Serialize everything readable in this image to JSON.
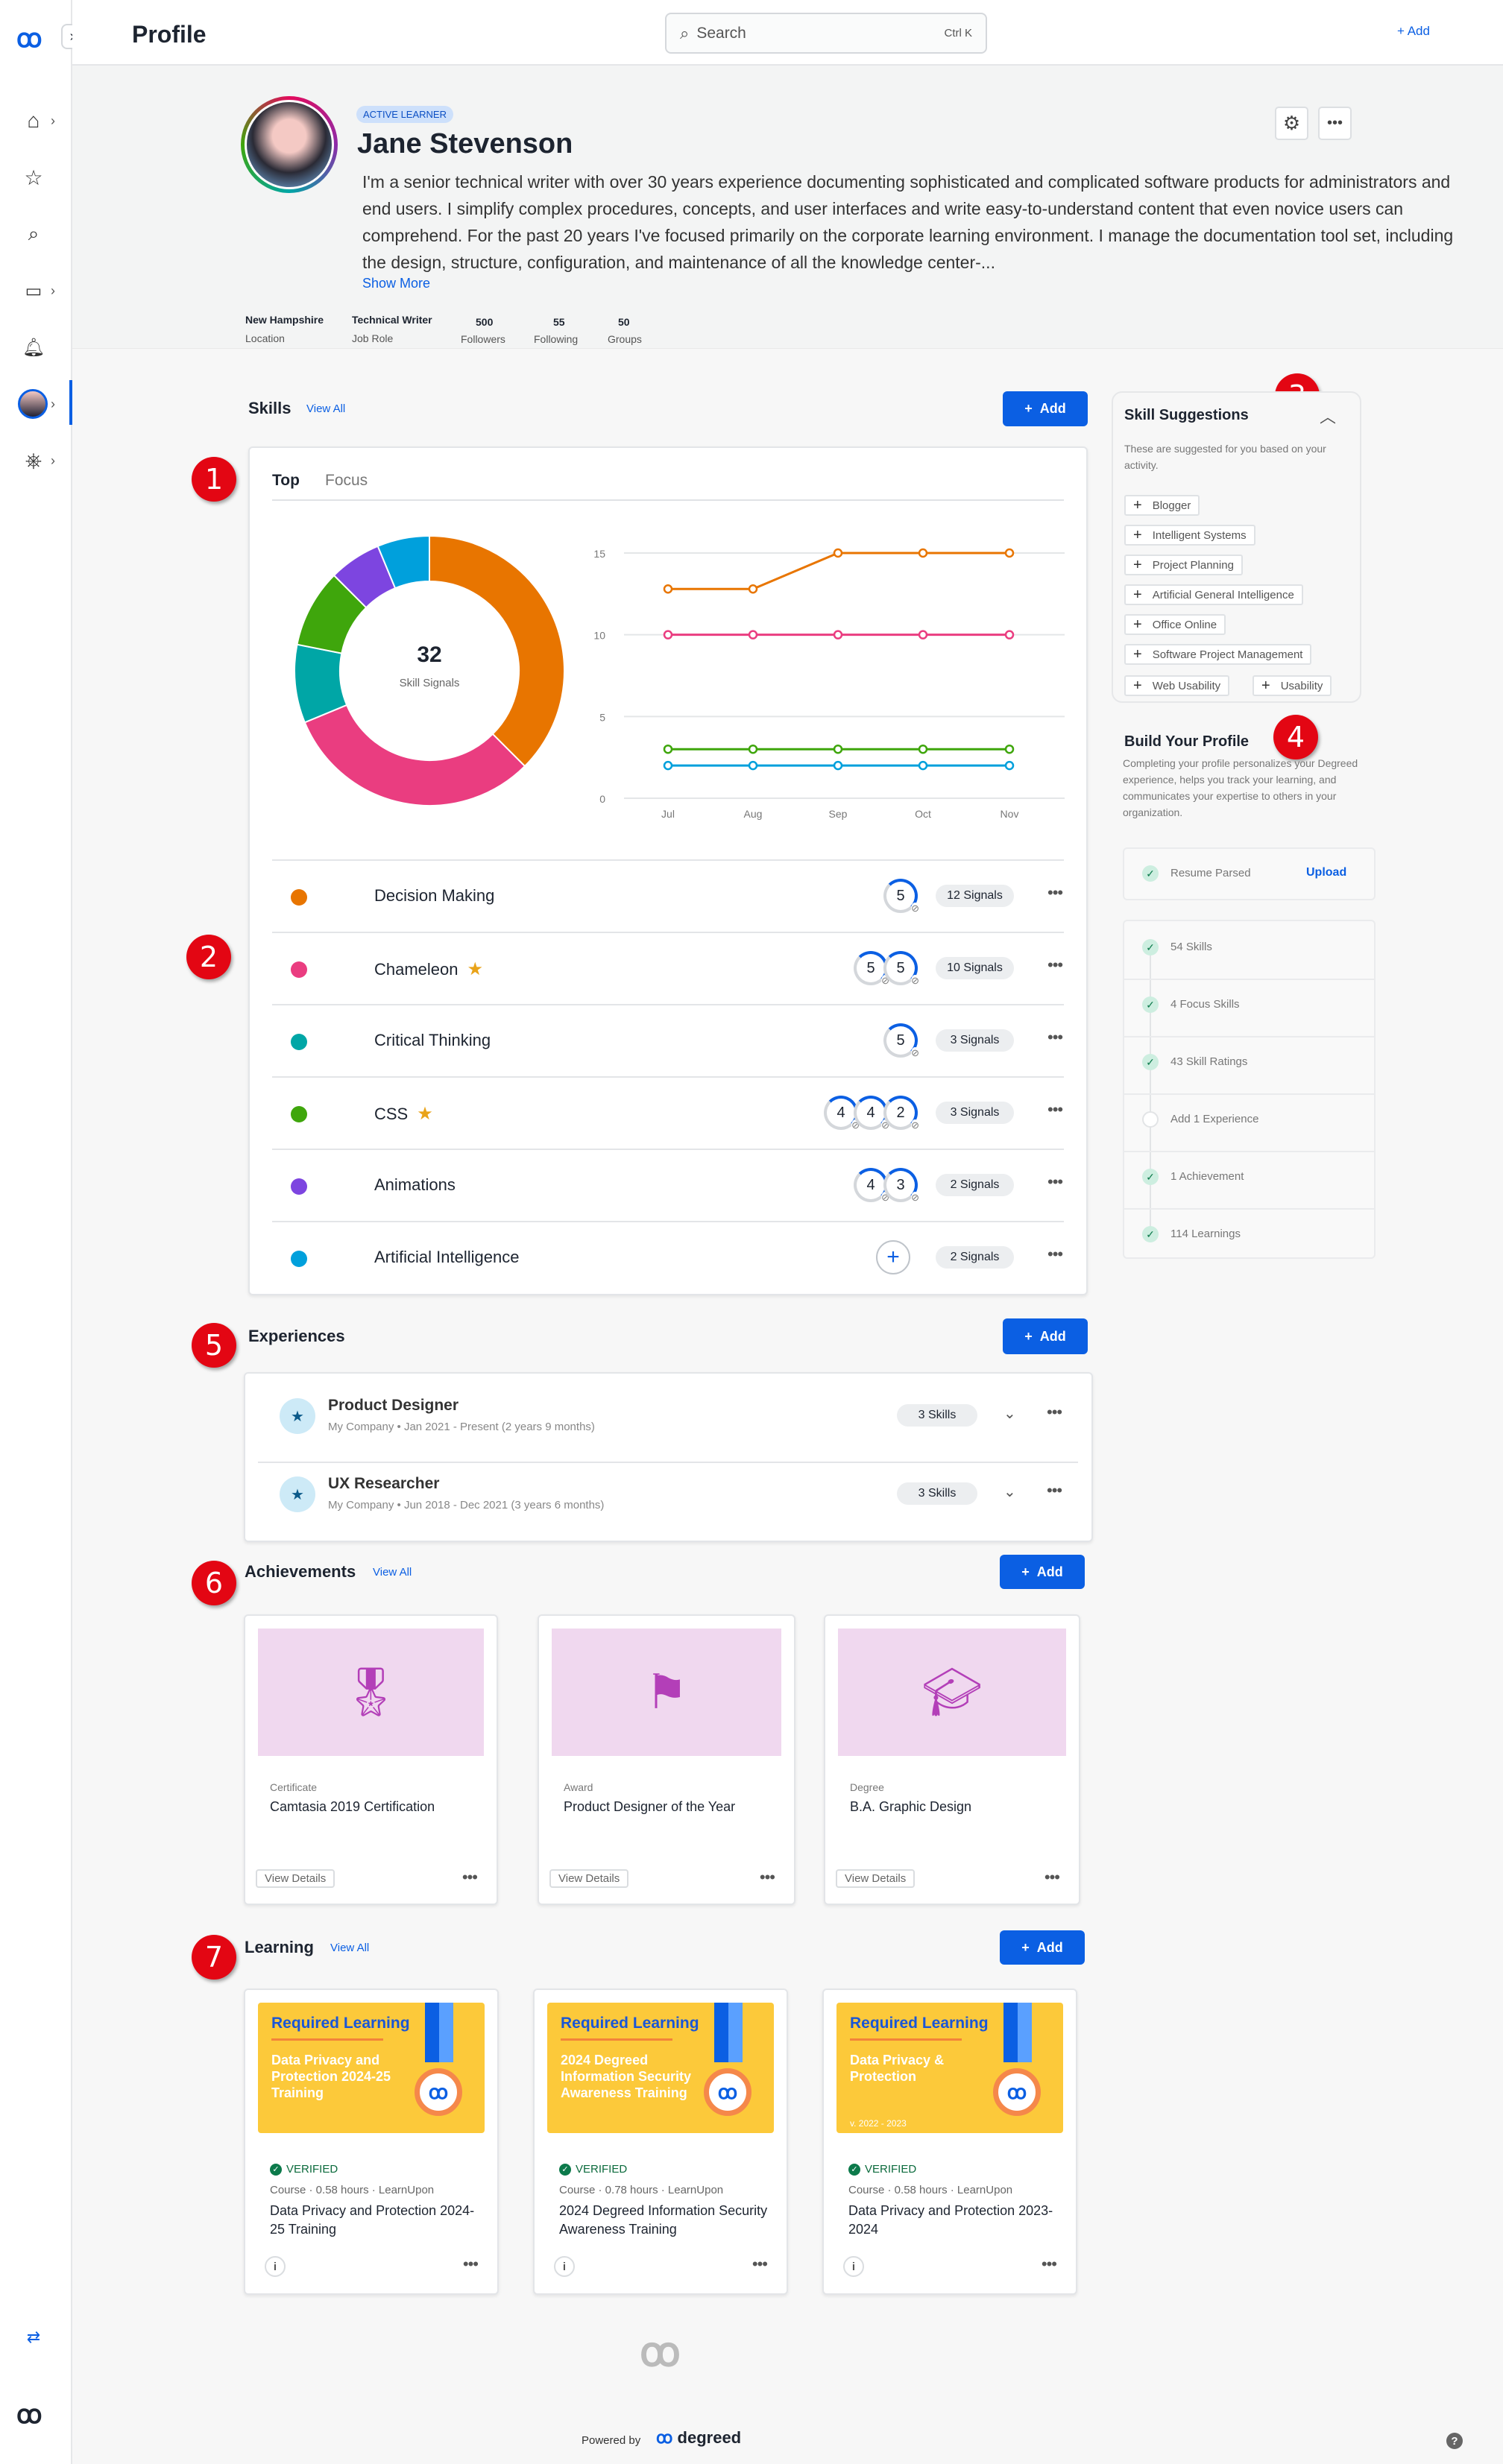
{
  "header": {
    "title": "Profile",
    "search_placeholder": "Search",
    "search_shortcut": "Ctrl K",
    "add_label": "Add"
  },
  "sidebar": {
    "icons": [
      "home-icon",
      "star-icon",
      "search-icon",
      "briefcase-icon",
      "bell-icon",
      "avatar",
      "settings-wheel-icon"
    ],
    "bottom_icon": "swap-icon",
    "logo": "degreed-logo"
  },
  "profile": {
    "badge": "ACTIVE LEARNER",
    "name": "Jane Stevenson",
    "bio": "I'm a senior technical writer with over 30 years experience documenting sophisticated and complicated software products for administrators and end users. I simplify complex procedures, concepts, and user interfaces and write easy-to-understand content that even novice users can comprehend. For the past 20 years I've focused primarily on the corporate learning environment. I manage the documentation tool set, including the design, structure, configuration, and maintenance of all the knowledge center-...",
    "show_more": "Show More",
    "stats": [
      {
        "value": "New Hampshire",
        "label": "Location"
      },
      {
        "value": "Technical Writer",
        "label": "Job Role"
      },
      {
        "value": "500",
        "label": "Followers"
      },
      {
        "value": "55",
        "label": "Following"
      },
      {
        "value": "50",
        "label": "Groups"
      }
    ]
  },
  "markers": [
    "1",
    "2",
    "3",
    "4",
    "5",
    "6",
    "7"
  ],
  "skills": {
    "title": "Skills",
    "view_all": "View All",
    "add": "Add",
    "tabs": [
      "Top",
      "Focus"
    ],
    "items": [
      {
        "name": "Decision Making",
        "color": "#e87500",
        "star": false,
        "ratings": [
          "5"
        ],
        "signals": "12 Signals"
      },
      {
        "name": "Chameleon",
        "color": "#ea3d80",
        "star": true,
        "ratings": [
          "5",
          "5"
        ],
        "signals": "10 Signals"
      },
      {
        "name": "Critical Thinking",
        "color": "#00a6a6",
        "star": false,
        "ratings": [
          "5"
        ],
        "signals": "3 Signals"
      },
      {
        "name": "CSS",
        "color": "#3fa60c",
        "star": true,
        "ratings": [
          "4",
          "4",
          "2"
        ],
        "signals": "3 Signals"
      },
      {
        "name": "Animations",
        "color": "#7d45e0",
        "star": false,
        "ratings": [
          "4",
          "3"
        ],
        "signals": "2 Signals"
      },
      {
        "name": "Artificial Intelligence",
        "color": "#00a0dc",
        "star": false,
        "ratings": [],
        "signals": "2 Signals"
      }
    ]
  },
  "chart_data": [
    {
      "type": "pie",
      "center_value": "32",
      "center_label": "Skill Signals",
      "categories": [
        "Decision Making",
        "Chameleon",
        "Critical Thinking",
        "CSS",
        "Animations",
        "Artificial Intelligence"
      ],
      "values": [
        12,
        10,
        3,
        3,
        2,
        2
      ],
      "colors": [
        "#e87500",
        "#ea3d80",
        "#00a6a6",
        "#3fa60c",
        "#7d45e0",
        "#00a0dc"
      ]
    },
    {
      "type": "line",
      "x": [
        "Jul",
        "Aug",
        "Sep",
        "Oct",
        "Nov"
      ],
      "ylim": [
        0,
        15
      ],
      "yticks": [
        "0",
        "5",
        "10",
        "15"
      ],
      "grid": true,
      "series": [
        {
          "values": [
            12.8,
            12.8,
            15,
            15,
            15
          ],
          "color": "#e87500"
        },
        {
          "values": [
            10,
            10,
            10,
            10,
            10
          ],
          "color": "#ea3d80"
        },
        {
          "values": [
            3,
            3,
            3,
            3,
            3
          ],
          "color": "#3fa60c"
        },
        {
          "values": [
            2,
            2,
            2,
            2,
            2
          ],
          "color": "#00a0dc"
        }
      ]
    }
  ],
  "suggestions": {
    "title": "Skill Suggestions",
    "desc": "These are suggested for you based on your activity.",
    "chips": [
      "Blogger",
      "Intelligent Systems",
      "Project Planning",
      "Artificial General Intelligence",
      "Office Online",
      "Software Project Management",
      "Web Usability",
      "Usability"
    ]
  },
  "build_profile": {
    "title": "Build Your Profile",
    "desc": "Completing your profile personalizes your Degreed experience, helps you track your learning, and communicates your expertise to others in your organization.",
    "resume": {
      "label": "Resume Parsed",
      "action": "Upload"
    },
    "items": [
      {
        "label": "54 Skills",
        "done": true
      },
      {
        "label": "4 Focus Skills",
        "done": true
      },
      {
        "label": "43 Skill Ratings",
        "done": true
      },
      {
        "label": "Add 1 Experience",
        "done": false
      },
      {
        "label": "1 Achievement",
        "done": true
      },
      {
        "label": "114 Learnings",
        "done": true
      }
    ]
  },
  "experiences": {
    "title": "Experiences",
    "add": "Add",
    "items": [
      {
        "title": "Product Designer",
        "sub": "My Company • Jan 2021 - Present (2 years 9 months)",
        "skills": "3 Skills"
      },
      {
        "title": "UX Researcher",
        "sub": "My Company • Jun 2018 - Dec 2021 (3 years 6 months)",
        "skills": "3 Skills"
      }
    ]
  },
  "achievements": {
    "title": "Achievements",
    "view_all": "View All",
    "add": "Add",
    "items": [
      {
        "type": "Certificate",
        "title": "Camtasia 2019 Certification",
        "action": "View Details",
        "icon": "certificate-icon"
      },
      {
        "type": "Award",
        "title": "Product Designer of the Year",
        "action": "View Details",
        "icon": "award-icon"
      },
      {
        "type": "Degree",
        "title": "B.A. Graphic Design",
        "action": "View Details",
        "icon": "graduation-cap-icon"
      }
    ]
  },
  "learning": {
    "title": "Learning",
    "view_all": "View All",
    "add": "Add",
    "items": [
      {
        "banner_head": "Required Learning",
        "banner_title": "Data Privacy and Protection 2024-25 Training",
        "verified": "VERIFIED",
        "meta": "Course · 0.58 hours · LearnUpon",
        "title": "Data Privacy and Protection 2024-25 Training"
      },
      {
        "banner_head": "Required Learning",
        "banner_title": "2024 Degreed Information Security Awareness Training",
        "verified": "VERIFIED",
        "meta": "Course · 0.78 hours · LearnUpon",
        "title": "2024 Degreed Information Security Awareness Training"
      },
      {
        "banner_head": "Required Learning",
        "banner_title": "Data Privacy & Protection",
        "banner_version": "v. 2022 - 2023",
        "verified": "VERIFIED",
        "meta": "Course · 0.58 hours · LearnUpon",
        "title": "Data Privacy and Protection 2023-2024"
      }
    ]
  },
  "footer": {
    "powered_by": "Powered by",
    "brand": "degreed",
    "help": "?"
  }
}
